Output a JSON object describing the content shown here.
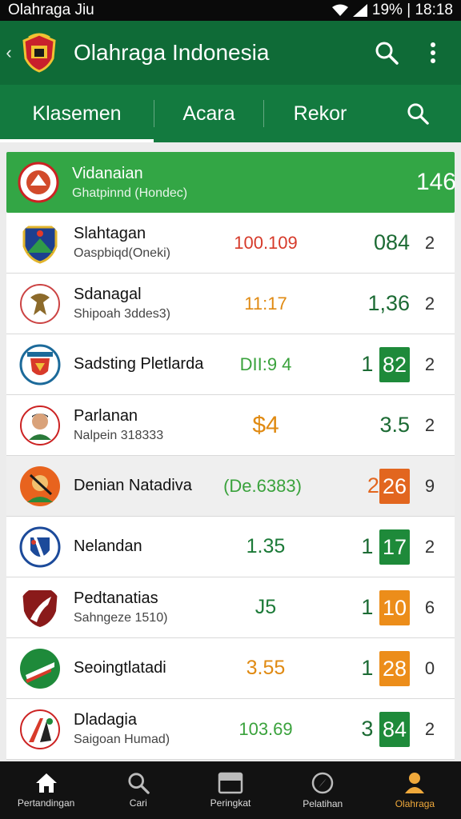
{
  "status": {
    "left": "Olahraga Jiu",
    "right": "19% | 18:18"
  },
  "app_bar": {
    "title": "Olahraga Indonesia"
  },
  "tabs": [
    {
      "label": "Klasemen"
    },
    {
      "label": "Acara"
    },
    {
      "label": "Rekor"
    }
  ],
  "leader": {
    "name": "Vidanaian",
    "sub": "Ghatpinnd (Hondec)",
    "points": "146"
  },
  "rows": [
    {
      "name": "Slahtagan",
      "sub": "Oaspbiqd(Oneki)",
      "odds": "100.109",
      "odds_color": "#d63a2a",
      "pts_a": "084",
      "pts_b": "",
      "pill": "",
      "rank": "2"
    },
    {
      "name": "Sdanagal",
      "sub": "Shipoah 3ddes3)",
      "odds": "11:17",
      "odds_color": "#e08a12",
      "pts_a": "1,36",
      "pts_b": "",
      "pill": "",
      "rank": "2"
    },
    {
      "name": "Sadsting Pletlarda",
      "sub": "",
      "odds": "DII:9 4",
      "odds_color": "#3aa23c",
      "pts_a": "1",
      "pts_b": "82",
      "pill": "green",
      "rank": "2"
    },
    {
      "name": "Parlanan",
      "sub": "Nalpein 318333",
      "odds": "$4",
      "odds_color": "#e08a12",
      "pts_a": "3.5",
      "pts_b": "",
      "pill": "",
      "rank": "2"
    },
    {
      "name": "Denian Natadiva",
      "sub": "",
      "odds": "(De.6383)",
      "odds_color": "#3aa23c",
      "pts_a": "2",
      "pts_b": "26",
      "pill": "orange",
      "rank": "9"
    },
    {
      "name": "Nelandan",
      "sub": "",
      "odds": "1.35",
      "odds_color": "#1c7a38",
      "pts_a": "1",
      "pts_b": "17",
      "pill": "green",
      "rank": "2"
    },
    {
      "name": "Pedtanatias",
      "sub": "Sahngeze 1510)",
      "odds": "J5",
      "odds_color": "#1c7a38",
      "pts_a": "1",
      "pts_b": "10",
      "pill": "orange",
      "rank": "6"
    },
    {
      "name": "Seoingtlatadi",
      "sub": "",
      "odds": "3.55",
      "odds_color": "#e08a12",
      "pts_a": "1",
      "pts_b": "28",
      "pill": "orange",
      "rank": "0"
    },
    {
      "name": "Dladagia",
      "sub": "Saigoan Humad)",
      "odds": "103.69",
      "odds_color": "#3aa23c",
      "pts_a": "3",
      "pts_b": "84",
      "pill": "green",
      "rank": "2"
    }
  ],
  "bottom_nav": [
    {
      "label": "Pertandingan",
      "icon": "home-icon"
    },
    {
      "label": "Cari",
      "icon": "search-icon"
    },
    {
      "label": "Peringkat",
      "icon": "tray-icon"
    },
    {
      "label": "Pelatihan",
      "icon": "compass-icon"
    },
    {
      "label": "Olahraga",
      "icon": "person-icon"
    }
  ],
  "colors": {
    "primary": "#0f6b37",
    "tab": "#137a3f",
    "leader": "#33a645",
    "pill_green": "#1e8a3a",
    "pill_orange": "#ec8d1a",
    "nav_active": "#f0a93b"
  }
}
